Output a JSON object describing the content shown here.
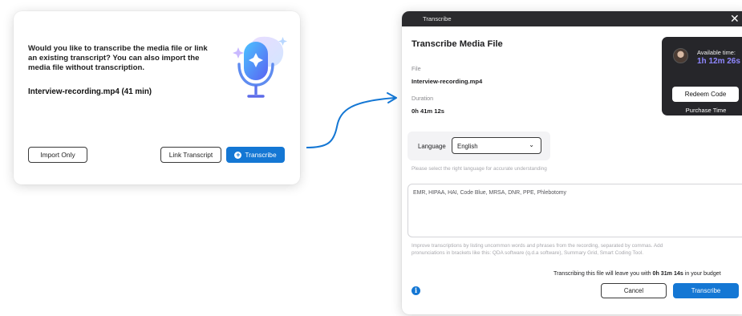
{
  "prompt_card": {
    "message": "Would you like to transcribe the media file or link an existing transcript? You can also import the media file without transcription.",
    "file_line": "Interview-recording.mp4 (41 min)",
    "import_label": "Import Only",
    "link_label": "Link Transcript",
    "transcribe_label": "Transcribe"
  },
  "dialog": {
    "window_title": "Transcribe",
    "close_glyph": "✕",
    "heading": "Transcribe Media File",
    "file_label": "File",
    "file_value": "Interview-recording.mp4",
    "duration_label": "Duration",
    "duration_value": "0h 41m 12s",
    "available_label": "Available time:",
    "available_value": "1h 12m 26s",
    "redeem_label": "Redeem Code",
    "purchase_label": "Purchase Time",
    "language_label": "Language",
    "language_value": "English",
    "language_hint": "Please select the right language for accurate understanding",
    "vocab_value": "EMR, HIPAA, HAI, Code Blue, MRSA, DNR, PPE, Phlebotomy",
    "vocab_hint_line1": "Improve transcriptions by listing uncommon words and phrases from the recording, separated by commas. Add",
    "vocab_hint_line2": "pronunciations in brackets like this: QDA software (q.d.a software), Summary Grid, Smart Coding Tool.",
    "budget_prefix": "Transcribing this file will leave you with ",
    "budget_value": "0h 31m 14s",
    "budget_suffix": " in your budget",
    "info_glyph": "i",
    "cancel_label": "Cancel",
    "transcribe_label": "Transcribe"
  },
  "icons": {
    "microphone": "microphone-icon",
    "plus": "plus-circle-icon",
    "chevron": "chevron-down-icon",
    "info": "info-icon",
    "close": "close-icon",
    "arrow": "arrow-right-icon"
  },
  "colors": {
    "accent": "#1477d4",
    "titlebar": "#2b2b2e",
    "time_panel": "#26262a",
    "time_value": "#8f87ff"
  }
}
